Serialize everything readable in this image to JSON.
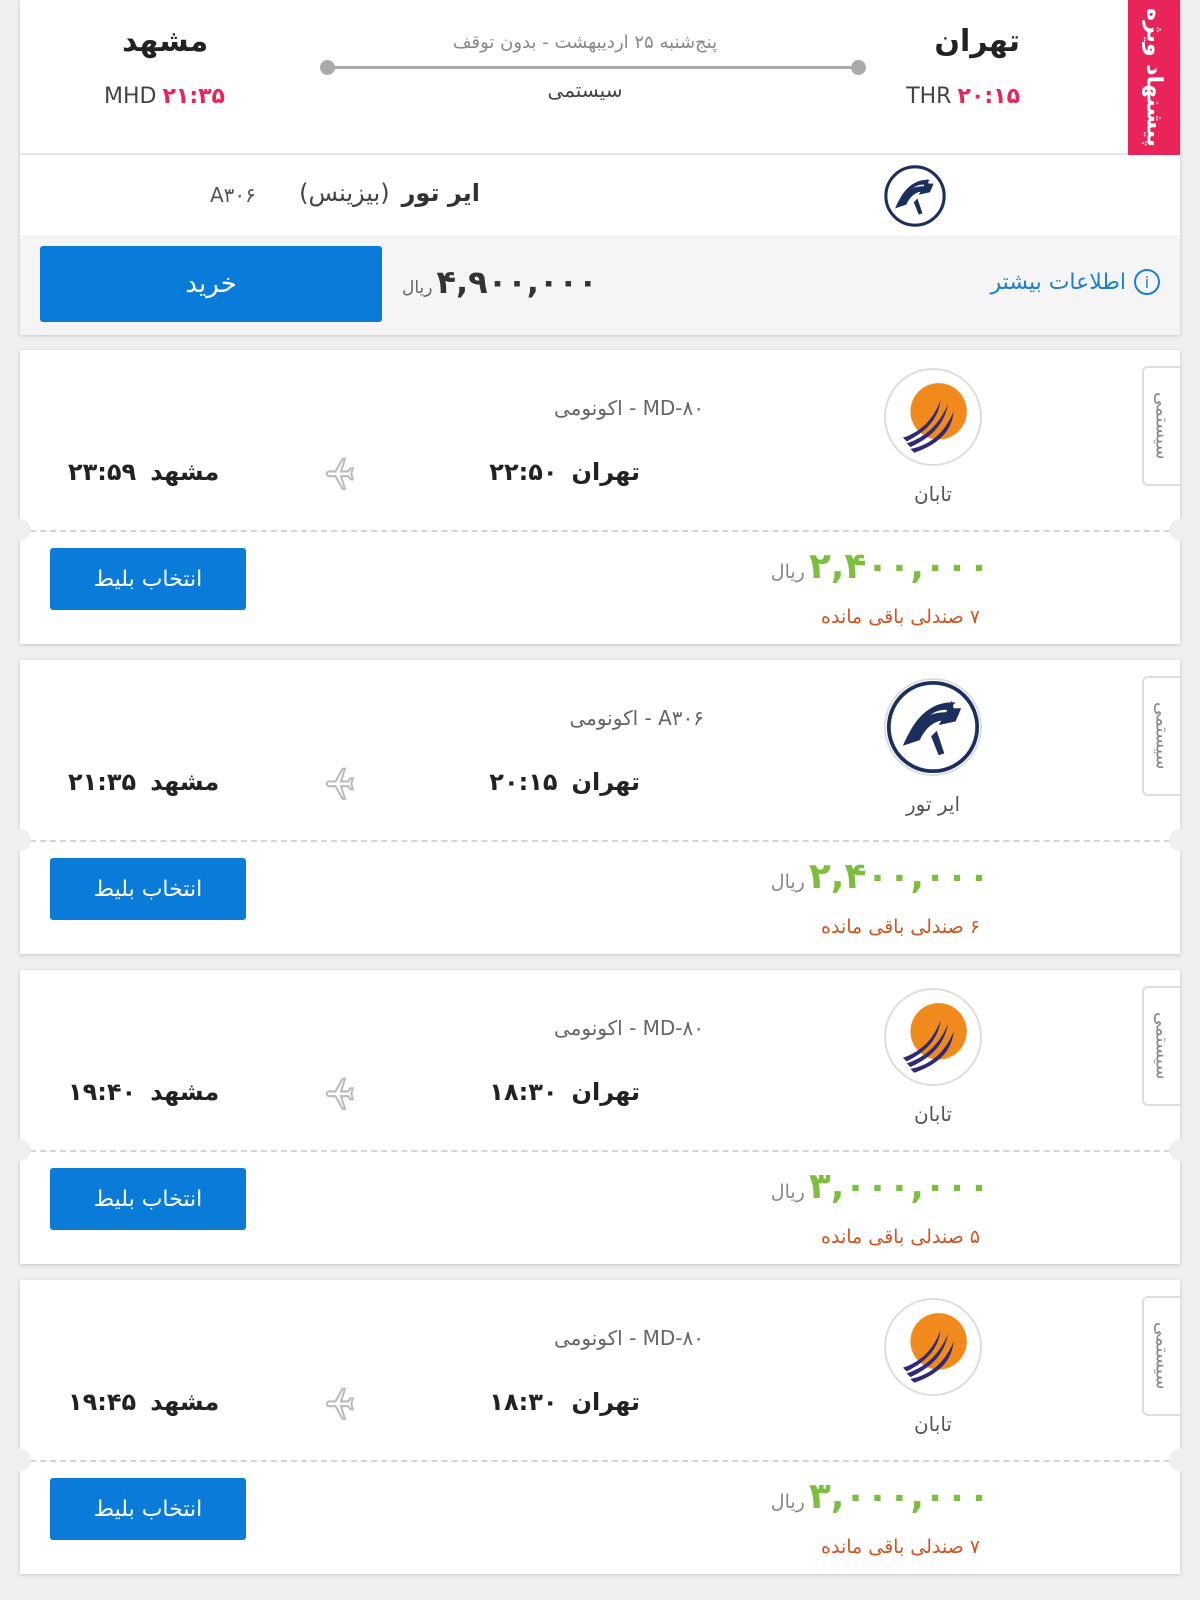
{
  "special": {
    "ribbon": "پیشنهاد ویژه",
    "origin_city": "تهران",
    "origin_code": "THR",
    "origin_time": "۲۰:۱۵",
    "dest_city": "مشهد",
    "dest_code": "MHD",
    "dest_time": "۲۱:۳۵",
    "date_stops": "پنج‌شنبه ۲۵ اردیبهشت - بدون توقف",
    "type": "سیستمی",
    "airline": "ایر تور",
    "class": "(بیزینس)",
    "flight_code": "A۳۰۶",
    "price": "۴,۹۰۰,۰۰۰",
    "currency": "ریال",
    "buy_label": "خرید",
    "more_info": "اطلاعات بیشتر"
  },
  "flights": [
    {
      "airline": "تابان",
      "logo": "taban-logo",
      "aircraft": "MD-۸۰ - اکونومی",
      "dep_city": "تهران",
      "dep_time": "۲۲:۵۰",
      "arr_city": "مشهد",
      "arr_time": "۲۳:۵۹",
      "price": "۲,۴۰۰,۰۰۰",
      "currency": "ریال",
      "seats": "۷ صندلی باقی مانده",
      "type": "سیستمی",
      "select_label": "انتخاب بلیط"
    },
    {
      "airline": "ایر تور",
      "logo": "airtour-logo",
      "aircraft": "A۳۰۶ - اکونومی",
      "dep_city": "تهران",
      "dep_time": "۲۰:۱۵",
      "arr_city": "مشهد",
      "arr_time": "۲۱:۳۵",
      "price": "۲,۴۰۰,۰۰۰",
      "currency": "ریال",
      "seats": "۶ صندلی باقی مانده",
      "type": "سیستمی",
      "select_label": "انتخاب بلیط"
    },
    {
      "airline": "تابان",
      "logo": "taban-logo",
      "aircraft": "MD-۸۰ - اکونومی",
      "dep_city": "تهران",
      "dep_time": "۱۸:۳۰",
      "arr_city": "مشهد",
      "arr_time": "۱۹:۴۰",
      "price": "۳,۰۰۰,۰۰۰",
      "currency": "ریال",
      "seats": "۵ صندلی باقی مانده",
      "type": "سیستمی",
      "select_label": "انتخاب بلیط"
    },
    {
      "airline": "تابان",
      "logo": "taban-logo",
      "aircraft": "MD-۸۰ - اکونومی",
      "dep_city": "تهران",
      "dep_time": "۱۸:۳۰",
      "arr_city": "مشهد",
      "arr_time": "۱۹:۴۵",
      "price": "۳,۰۰۰,۰۰۰",
      "currency": "ریال",
      "seats": "۷ صندلی باقی مانده",
      "type": "سیستمی",
      "select_label": "انتخاب بلیط"
    }
  ],
  "colors": {
    "accent_blue": "#0a7bd8",
    "special_red": "#e8245a",
    "price_green": "#7cbf3e",
    "seats_orange": "#d2541e"
  }
}
